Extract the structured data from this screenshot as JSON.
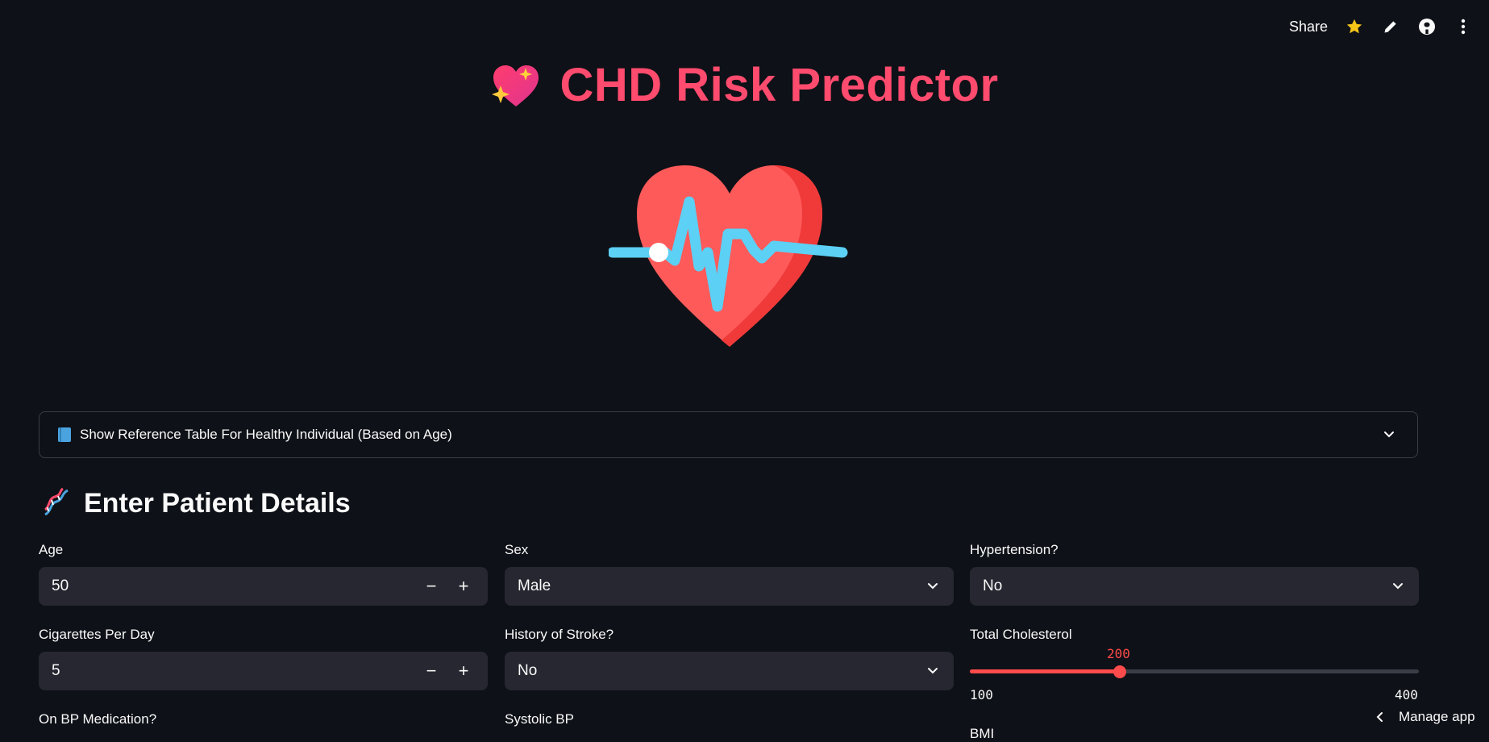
{
  "toolbar": {
    "share_label": "Share",
    "icons": [
      "star-icon",
      "pencil-icon",
      "github-icon",
      "more-vertical-icon"
    ],
    "star_color": "#f5c518"
  },
  "header": {
    "title": "CHD Risk Predictor",
    "title_color": "#ff4b6e",
    "icon": "sparkling-heart-icon"
  },
  "hero_image": "heart-pulse-illustration",
  "expander": {
    "icon": "blue-book-icon",
    "label": "Show Reference Table For Healthy Individual (Based on Age)"
  },
  "section": {
    "icon": "dna-icon",
    "title": "Enter Patient Details"
  },
  "fields": {
    "age": {
      "label": "Age",
      "value": "50"
    },
    "sex": {
      "label": "Sex",
      "value": "Male"
    },
    "hypertension": {
      "label": "Hypertension?",
      "value": "No"
    },
    "cigs": {
      "label": "Cigarettes Per Day",
      "value": "5"
    },
    "stroke": {
      "label": "History of Stroke?",
      "value": "No"
    },
    "cholesterol": {
      "label": "Total Cholesterol",
      "value": "200",
      "min": "100",
      "max": "400"
    },
    "bp_meds": {
      "label": "On BP Medication?"
    },
    "systolic": {
      "label": "Systolic BP"
    },
    "bmi": {
      "label": "BMI"
    }
  },
  "stepper": {
    "minus": "−",
    "plus": "+"
  },
  "colors": {
    "background": "#0e1117",
    "input_bg": "#262730",
    "accent": "#ff4b4b"
  },
  "footer": {
    "manage_label": "Manage app"
  }
}
